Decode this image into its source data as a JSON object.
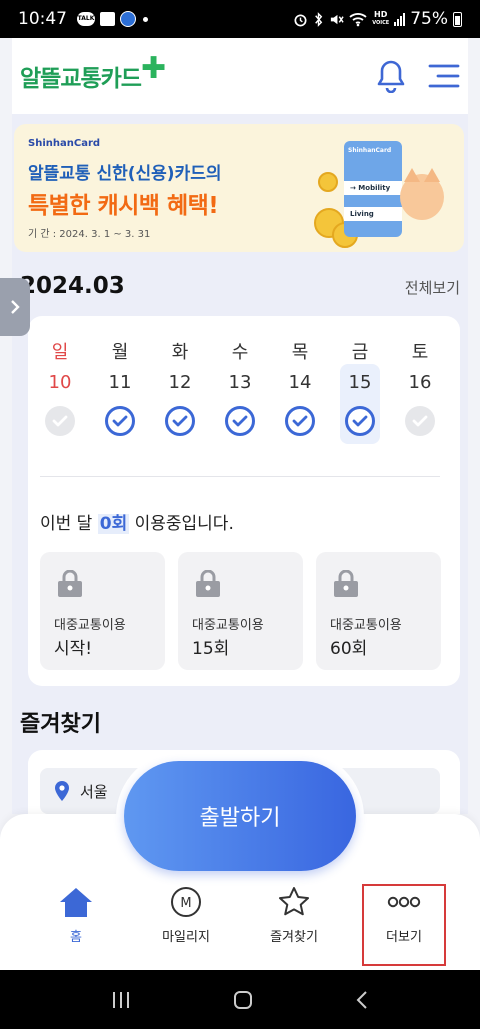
{
  "status_bar": {
    "time": "10:47",
    "talk_badge": "TALK",
    "hd_label": "HD",
    "voice_label": "VOICE",
    "battery": "75%"
  },
  "header": {
    "logo_text": "알뜰교통카드",
    "logo_plus": "✚"
  },
  "banner": {
    "brand": "ShinhanCard",
    "line1": "알뜰교통 신한(신용)카드의",
    "line2": "특별한 캐시백 혜택!",
    "period": "기 간 : 2024. 3. 1 ~ 3. 31",
    "card_brand": "ShinhanCard",
    "card_mobility": "→ Mobility",
    "card_living": "Living"
  },
  "calendar": {
    "month": "2024.03",
    "view_all": "전체보기",
    "days": [
      {
        "name": "일",
        "date": "10",
        "checked": false,
        "sunday": true
      },
      {
        "name": "월",
        "date": "11",
        "checked": true
      },
      {
        "name": "화",
        "date": "12",
        "checked": true
      },
      {
        "name": "수",
        "date": "13",
        "checked": true
      },
      {
        "name": "목",
        "date": "14",
        "checked": true
      },
      {
        "name": "금",
        "date": "15",
        "checked": true,
        "today": true
      },
      {
        "name": "토",
        "date": "16",
        "checked": false
      }
    ],
    "usage_prefix": "이번 달",
    "usage_count": "0회",
    "usage_suffix": "이용중입니다.",
    "rewards": [
      {
        "label": "대중교통이용",
        "value": "시작!"
      },
      {
        "label": "대중교통이용",
        "value": "15회"
      },
      {
        "label": "대중교통이용",
        "value": "60회"
      }
    ]
  },
  "favorites": {
    "title": "즐겨찾기",
    "item": "서울"
  },
  "depart_button": "출발하기",
  "bottom_nav": {
    "items": [
      {
        "label": "홈",
        "active": true
      },
      {
        "label": "마일리지",
        "icon_letter": "M"
      },
      {
        "label": "즐겨찾기"
      },
      {
        "label": "더보기"
      }
    ]
  },
  "colors": {
    "primary": "#3c68d6",
    "brand_green": "#1f9e57",
    "highlight": "#d63a3a"
  }
}
